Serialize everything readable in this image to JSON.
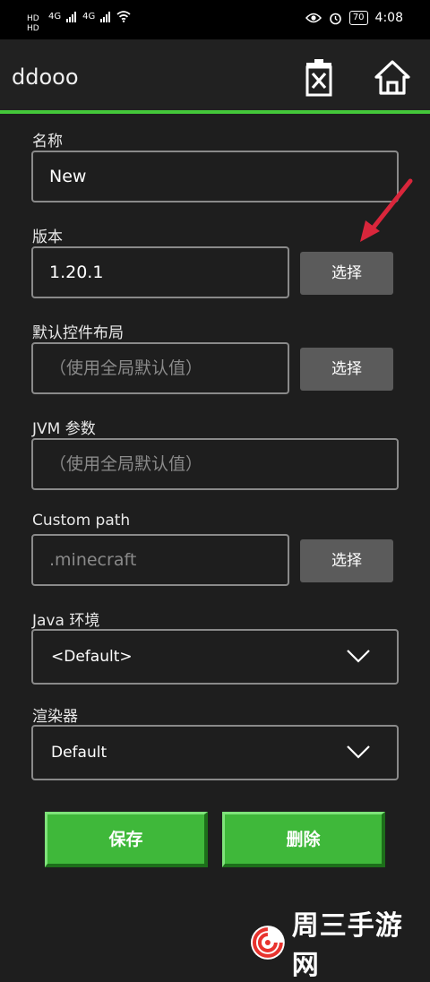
{
  "status_bar": {
    "hd_top": "HD",
    "hd_bottom": "HD",
    "net1": "4G",
    "net2": "4G",
    "battery": "70",
    "time": "4:08",
    "icons": [
      "signal-icon",
      "wifi-icon",
      "eye-icon",
      "alarm-icon",
      "battery-icon"
    ]
  },
  "app_bar": {
    "title": "ddooo",
    "delete_icon": "delete-icon",
    "home_icon": "home-icon",
    "accent_color": "#44c73a"
  },
  "form": {
    "name": {
      "label": "名称",
      "value": "New"
    },
    "version": {
      "label": "版本",
      "value": "1.20.1",
      "button": "选择"
    },
    "layout": {
      "label": "默认控件布局",
      "placeholder": "（使用全局默认值）",
      "button": "选择"
    },
    "jvm": {
      "label": "JVM 参数",
      "placeholder": "（使用全局默认值）"
    },
    "custom_path": {
      "label": "Custom path",
      "placeholder": ".minecraft",
      "button": "选择"
    },
    "java": {
      "label": "Java 环境",
      "selected": "<Default>"
    },
    "renderer": {
      "label": "渲染器",
      "selected": "Default"
    }
  },
  "actions": {
    "save": "保存",
    "delete": "删除"
  },
  "watermark": {
    "text": "周三手游网"
  }
}
